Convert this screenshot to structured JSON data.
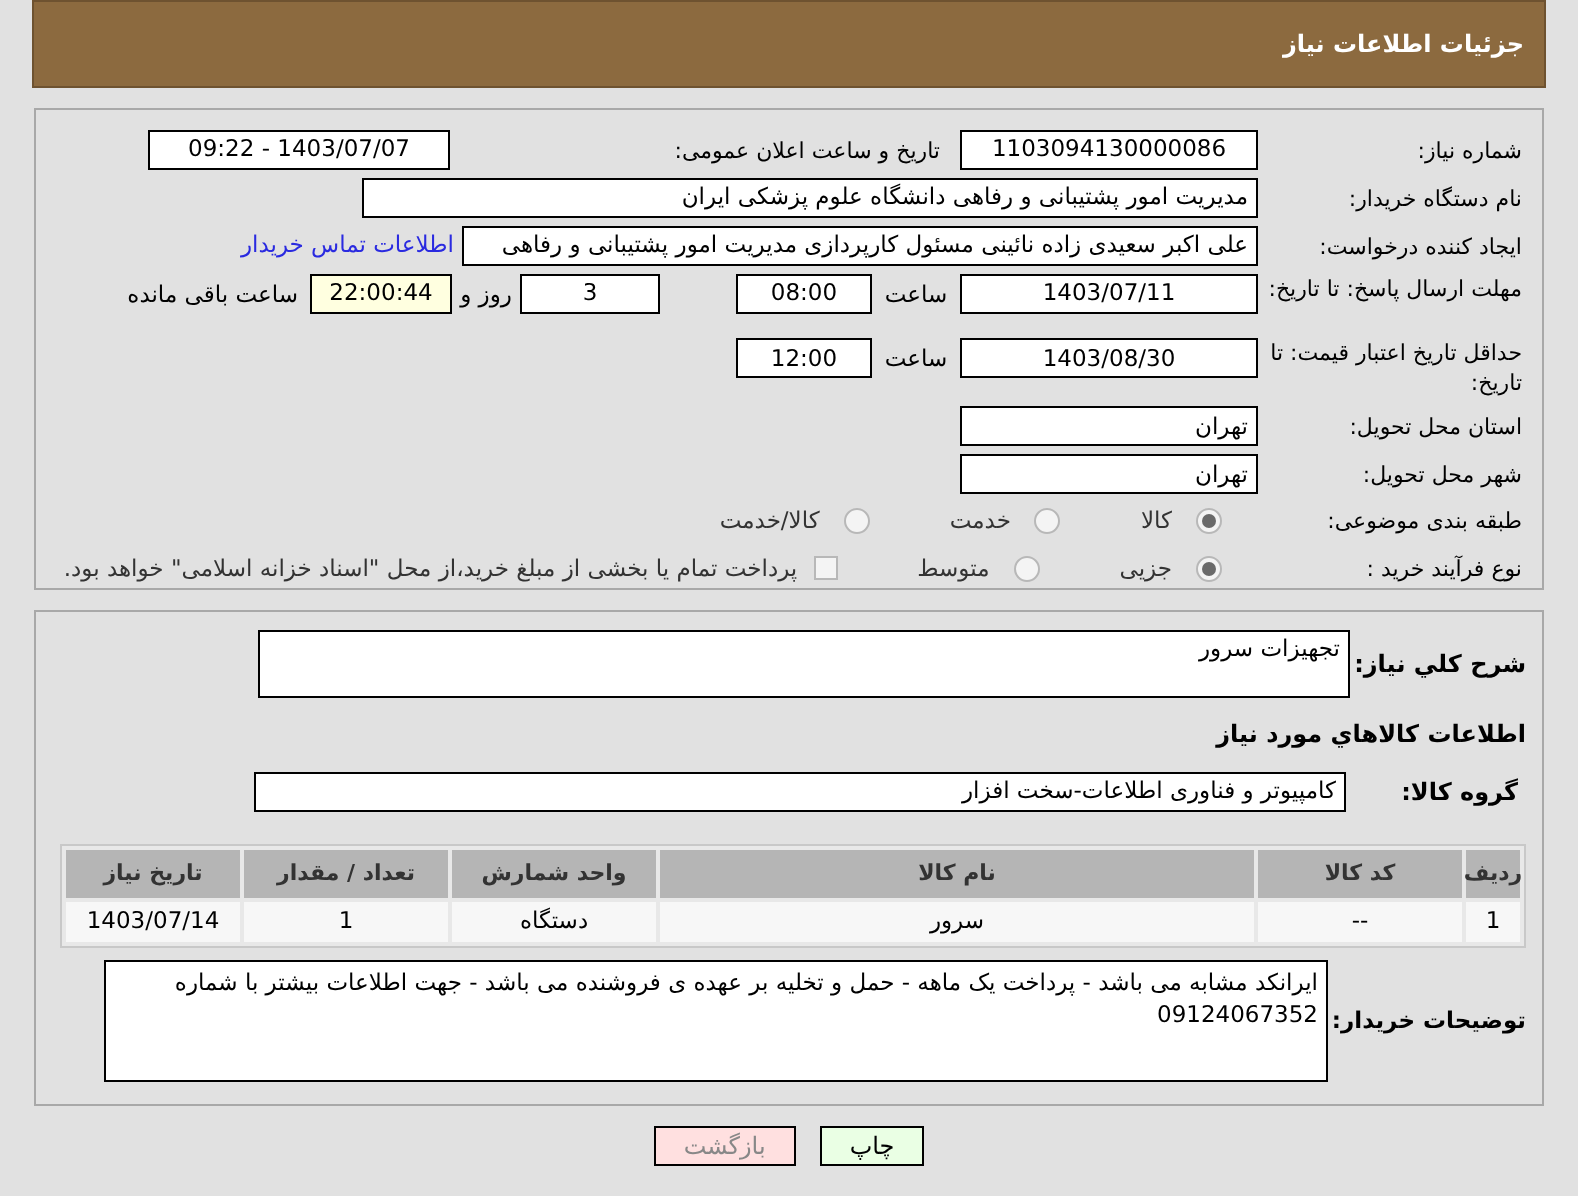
{
  "header": {
    "title": "جزئیات اطلاعات نیاز"
  },
  "need_number": {
    "label": "شماره نیاز:",
    "value": "1103094130000086"
  },
  "announce": {
    "label": "تاریخ و ساعت اعلان عمومی:",
    "value": "1403/07/07 - 09:22"
  },
  "buyer_org": {
    "label": "نام دستگاه خریدار:",
    "value": "مدیریت امور پشتیبانی و رفاهی دانشگاه علوم پزشکی ایران"
  },
  "requester": {
    "label": "ایجاد کننده درخواست:",
    "value": "علی اکبر سعیدی زاده نائینی مسئول کارپردازی مدیریت امور پشتیبانی و رفاهی",
    "link": "اطلاعات تماس خریدار"
  },
  "deadline": {
    "label": "مهلت ارسال پاسخ: تا تاریخ:",
    "date": "1403/07/11",
    "time_label": "ساعت",
    "time": "08:00",
    "days": "3",
    "days_label": "روز و",
    "remaining": "22:00:44",
    "remaining_label": "ساعت باقی مانده"
  },
  "validity": {
    "label": "حداقل تاریخ اعتبار قیمت: تا تاریخ:",
    "date": "1403/08/30",
    "time_label": "ساعت",
    "time": "12:00"
  },
  "province": {
    "label": "استان محل تحویل:",
    "value": "تهران"
  },
  "city": {
    "label": "شهر محل تحویل:",
    "value": "تهران"
  },
  "category": {
    "label": "طبقه بندی موضوعی:",
    "options": [
      {
        "label": "کالا",
        "selected": true
      },
      {
        "label": "خدمت",
        "selected": false
      },
      {
        "label": "کالا/خدمت",
        "selected": false
      }
    ]
  },
  "process": {
    "label": "نوع فرآیند خرید :",
    "options": [
      {
        "label": "جزیی",
        "selected": true
      },
      {
        "label": "متوسط",
        "selected": false
      }
    ],
    "treasury": {
      "checked": false,
      "text": "پرداخت تمام یا بخشی از مبلغ خرید،از محل \"اسناد خزانه اسلامی\" خواهد بود."
    }
  },
  "description": {
    "label": "شرح کلي نياز:",
    "value": "تجهیزات سرور"
  },
  "items_heading": "اطلاعات کالاهاي مورد نياز",
  "goods_group": {
    "label": "گروه کالا:",
    "value": "کامپیوتر و فناوری اطلاعات-سخت افزار"
  },
  "table": {
    "columns": [
      "ردیف",
      "کد کالا",
      "نام کالا",
      "واحد شمارش",
      "تعداد / مقدار",
      "تاریخ نیاز"
    ],
    "rows": [
      [
        "1",
        "--",
        "سرور",
        "دستگاه",
        "1",
        "1403/07/14"
      ]
    ]
  },
  "buyer_notes": {
    "label": "توضیحات خریدار:",
    "value": "ایرانکد مشابه می باشد - پرداخت یک ماهه - حمل و تخلیه بر عهده ی فروشنده می باشد - جهت اطلاعات بیشتر با شماره 09124067352"
  },
  "buttons": [
    {
      "label": "چاپ",
      "kind": "print"
    },
    {
      "label": "بازگشت",
      "kind": "back"
    }
  ]
}
